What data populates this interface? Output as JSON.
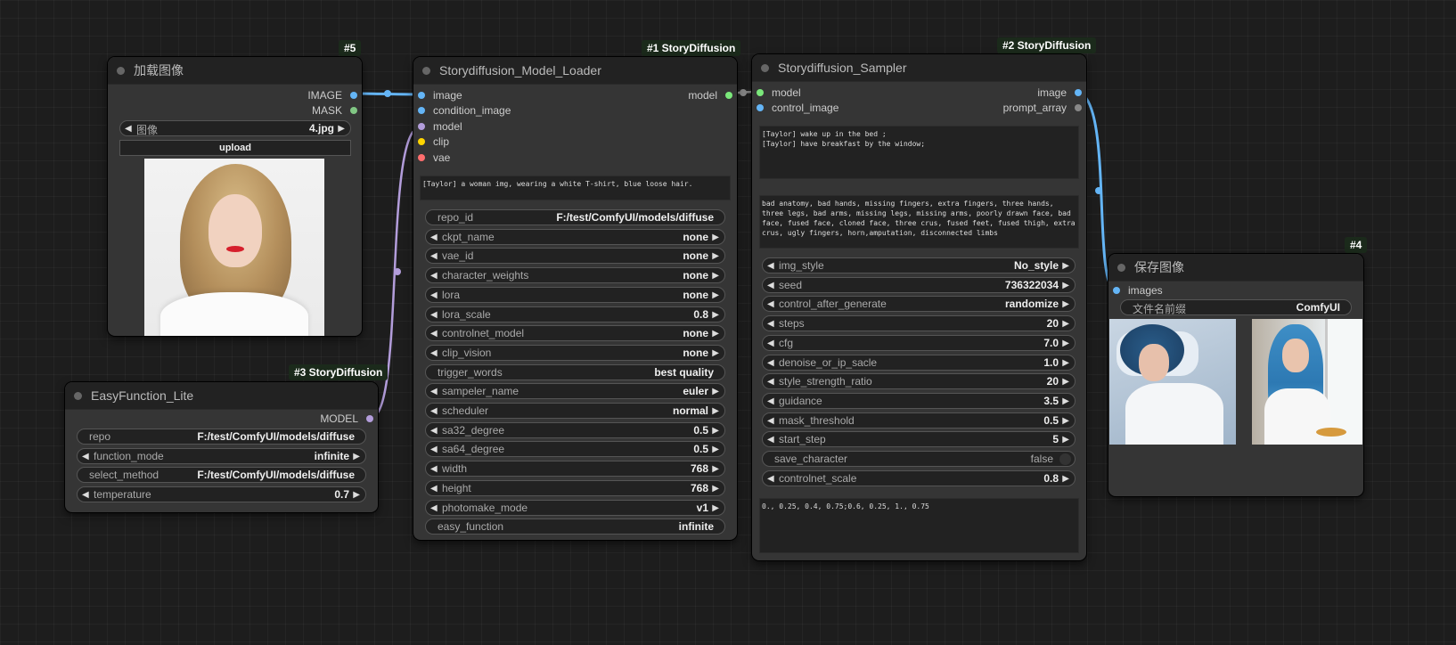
{
  "colors": {
    "image": "#64b5f6",
    "mask": "#81c784",
    "model": "#b39ddb",
    "model_out": "#7be87b",
    "clip": "#ffd500",
    "vae": "#ff6e6e",
    "gray": "#888888",
    "badge_bg": "#1b2a1b"
  },
  "load_image": {
    "badge": "#5",
    "title": "加载图像",
    "out_image": "IMAGE",
    "out_mask": "MASK",
    "image_label": "图像",
    "image_value": "4.jpg",
    "upload": "upload",
    "preview": "portrait photo preview"
  },
  "model_loader": {
    "badge": "#1 StoryDiffusion",
    "title": "Storydiffusion_Model_Loader",
    "inputs": [
      "image",
      "condition_image",
      "model",
      "clip",
      "vae"
    ],
    "output": "model",
    "prompt": "[Taylor] a woman img, wearing a white T-shirt, blue loose hair.",
    "widgets": [
      {
        "label": "repo_id",
        "value": "F:/test/ComfyUI/models/diffuse",
        "arrows": false
      },
      {
        "label": "ckpt_name",
        "value": "none",
        "arrows": true
      },
      {
        "label": "vae_id",
        "value": "none",
        "arrows": true
      },
      {
        "label": "character_weights",
        "value": "none",
        "arrows": true
      },
      {
        "label": "lora",
        "value": "none",
        "arrows": true
      },
      {
        "label": "lora_scale",
        "value": "0.8",
        "arrows": true
      },
      {
        "label": "controlnet_model",
        "value": "none",
        "arrows": true
      },
      {
        "label": "clip_vision",
        "value": "none",
        "arrows": true
      },
      {
        "label": "trigger_words",
        "value": "best quality",
        "arrows": false
      },
      {
        "label": "sampeler_name",
        "value": "euler",
        "arrows": true
      },
      {
        "label": "scheduler",
        "value": "normal",
        "arrows": true
      },
      {
        "label": "sa32_degree",
        "value": "0.5",
        "arrows": true
      },
      {
        "label": "sa64_degree",
        "value": "0.5",
        "arrows": true
      },
      {
        "label": "width",
        "value": "768",
        "arrows": true
      },
      {
        "label": "height",
        "value": "768",
        "arrows": true
      },
      {
        "label": "photomake_mode",
        "value": "v1",
        "arrows": true
      },
      {
        "label": "easy_function",
        "value": "infinite",
        "arrows": false
      }
    ]
  },
  "sampler": {
    "badge": "#2 StoryDiffusion",
    "title": "Storydiffusion_Sampler",
    "inputs": [
      "model",
      "control_image"
    ],
    "outputs": [
      "image",
      "prompt_array"
    ],
    "prompt": "[Taylor] wake up in the bed ;\n[Taylor] have breakfast by the window;",
    "negative": "bad anatomy, bad hands, missing fingers, extra fingers, three hands, three legs, bad arms, missing legs, missing arms, poorly drawn face, bad face, fused face, cloned face, three crus, fused feet, fused thigh, extra crus, ugly fingers, horn,amputation, disconnected limbs",
    "widgets": [
      {
        "label": "img_style",
        "value": "No_style",
        "arrows": true
      },
      {
        "label": "seed",
        "value": "736322034",
        "arrows": true
      },
      {
        "label": "control_after_generate",
        "value": "randomize",
        "arrows": true
      },
      {
        "label": "steps",
        "value": "20",
        "arrows": true
      },
      {
        "label": "cfg",
        "value": "7.0",
        "arrows": true
      },
      {
        "label": "denoise_or_ip_sacle",
        "value": "1.0",
        "arrows": true
      },
      {
        "label": "style_strength_ratio",
        "value": "20",
        "arrows": true
      },
      {
        "label": "guidance",
        "value": "3.5",
        "arrows": true
      },
      {
        "label": "mask_threshold",
        "value": "0.5",
        "arrows": true
      },
      {
        "label": "start_step",
        "value": "5",
        "arrows": true
      },
      {
        "label": "save_character",
        "value": "false",
        "arrows": false,
        "toggle": true
      },
      {
        "label": "controlnet_scale",
        "value": "0.8",
        "arrows": true
      }
    ],
    "weights": "0., 0.25, 0.4, 0.75;0.6, 0.25, 1., 0.75"
  },
  "easy_function": {
    "badge": "#3 StoryDiffusion",
    "title": "EasyFunction_Lite",
    "output": "MODEL",
    "widgets": [
      {
        "label": "repo",
        "value": "F:/test/ComfyUI/models/diffuse",
        "arrows": false
      },
      {
        "label": "function_mode",
        "value": "infinite",
        "arrows": true
      },
      {
        "label": "select_method",
        "value": "F:/test/ComfyUI/models/diffuse",
        "arrows": false
      },
      {
        "label": "temperature",
        "value": "0.7",
        "arrows": true
      }
    ]
  },
  "save_image": {
    "badge": "#4",
    "title": "保存图像",
    "input": "images",
    "prefix_label": "文件名前缀",
    "prefix_value": "ComfyUI",
    "images": [
      "woman lying in bed",
      "woman eating breakfast by window"
    ]
  }
}
